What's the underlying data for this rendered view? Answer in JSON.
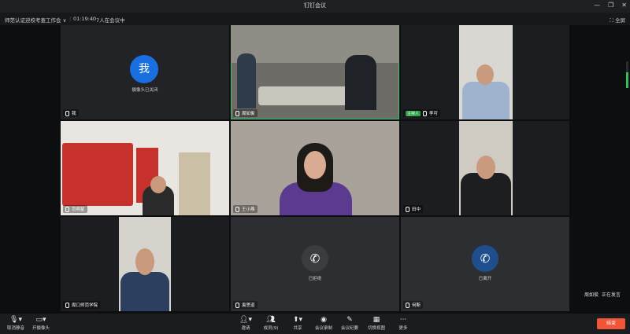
{
  "window": {
    "title": "钉钉会议",
    "minimize": "—",
    "maximize": "❐",
    "close": "✕"
  },
  "info": {
    "meeting_name": "师范认证迎校考查工作会",
    "dropdown": "∨",
    "timer": "01:19:40",
    "participants": "7人在会议中",
    "fullscreen_icon": "⛶",
    "fullscreen_label": "全屏"
  },
  "tiles": [
    {
      "name": "我",
      "camera_off_text": "摄像头已关闭",
      "avatar_char": "我"
    },
    {
      "name": "周如俊"
    },
    {
      "name": "李可",
      "host_badge": "主持人"
    },
    {
      "name": "范明星"
    },
    {
      "name": "王小燕"
    },
    {
      "name": "田中"
    },
    {
      "name": "周口师范学院"
    },
    {
      "name": "袁思道",
      "status": "已拒绝"
    },
    {
      "name": "何斯",
      "status": "已离开",
      "phone_caption": "Lef5"
    }
  ],
  "speaking": {
    "speaker": "周如俊",
    "label": "正在发言"
  },
  "toolbar": {
    "unmute": "取消静音",
    "camera": "开摄像头",
    "invite": "邀请",
    "members": "成员(9)",
    "share": "共享",
    "record": "会议录制",
    "whiteboard": "会议纪要",
    "layout": "切换视图",
    "more": "更多",
    "end": "结束"
  },
  "colors": {
    "accent": "#35c26b",
    "end": "#f0553a",
    "avatar": "#1a6fe0"
  }
}
